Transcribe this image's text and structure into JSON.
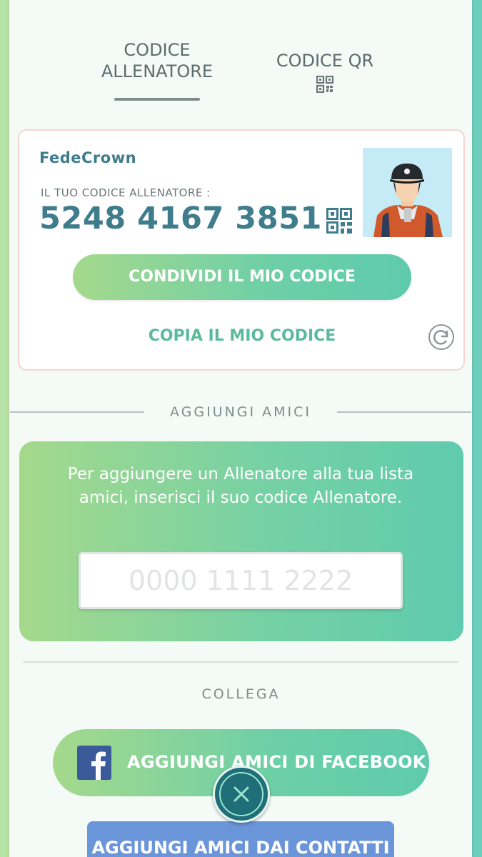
{
  "status_bar": {
    "text": "...."
  },
  "tabs": {
    "trainer_code_label_line1": "CODICE",
    "trainer_code_label_line2": "ALLENATORE",
    "qr_code_label": "CODICE QR"
  },
  "card": {
    "trainer_name": "FedeCrown",
    "code_label": "IL TUO CODICE ALLENATORE :",
    "code_value": "5248 4167 3851",
    "share_button": "CONDIVIDI IL MIO CODICE",
    "copy_button": "COPIA IL MIO CODICE"
  },
  "add_friends": {
    "title": "AGGIUNGI AMICI",
    "instruction": "Per aggiungere un Allenatore alla tua lista amici, inserisci il suo codice Allenatore.",
    "input_placeholder": "0000 1111 2222"
  },
  "connect": {
    "title": "COLLEGA",
    "facebook_button": "AGGIUNGI AMICI DI FACEBOOK",
    "contacts_button": "AGGIUNGI AMICI DAI CONTATTI"
  },
  "icons": [
    "qr-code-icon",
    "refresh-icon",
    "facebook-icon",
    "close-icon"
  ],
  "colors": {
    "accent_teal": "#3f7c8c",
    "button_green": "#6ccfa8",
    "copy_text": "#5bb99d",
    "contacts_blue": "#6b95d9",
    "close_dark": "#1f6e78"
  }
}
